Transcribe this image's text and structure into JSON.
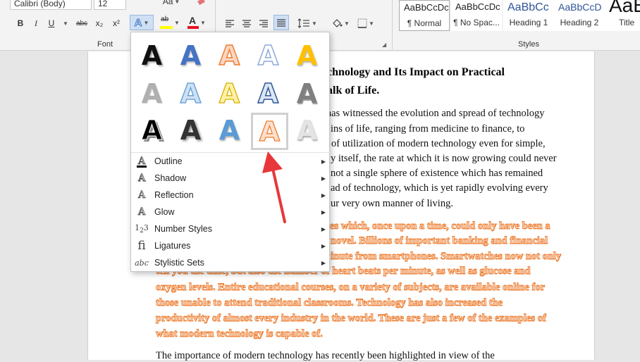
{
  "ribbon": {
    "font_name": "Calibri (Body)",
    "font_size": "12",
    "font_group_label": "Font",
    "styles_group_label": "Styles",
    "aa_label": "Aa",
    "buttons": {
      "bold": "B",
      "italic": "I",
      "underline": "U",
      "strikethrough": "abc",
      "subscript": "x₂",
      "superscript": "x²",
      "text_effects": "A",
      "highlight": "ab",
      "font_color": "A"
    },
    "styles": [
      {
        "sample": "AaBbCcDc",
        "name": "¶ Normal"
      },
      {
        "sample": "AaBbCcDc",
        "name": "¶ No Spac..."
      },
      {
        "sample": "AaBbCc",
        "name": "Heading 1"
      },
      {
        "sample": "AaBbCcD",
        "name": "Heading 2"
      },
      {
        "sample": "AaB",
        "name": "Title"
      }
    ]
  },
  "text_effects_menu": {
    "effect_glyph": "A",
    "items": [
      {
        "label": "Outline",
        "icon": "outline-icon"
      },
      {
        "label": "Shadow",
        "icon": "shadow-icon"
      },
      {
        "label": "Reflection",
        "icon": "reflection-icon"
      },
      {
        "label": "Glow",
        "icon": "glow-icon"
      },
      {
        "label": "Number Styles",
        "icon": "number-styles-icon"
      },
      {
        "label": "Ligatures",
        "icon": "ligatures-icon"
      },
      {
        "label": "Stylistic Sets",
        "icon": "stylistic-sets-icon"
      }
    ]
  },
  "document": {
    "title_line1": "chnology and Its Impact on Practical",
    "title_line2": "alk of Life.",
    "para1": [
      "d has witnessed the evolution and spread of technology",
      "ins of life, ranging from medicine to finance, to",
      "of utilization of modern technology even for simple,",
      "y itself, the rate at which it is now growing could never",
      "not a single sphere of existence which has remained",
      "ad of technology, which is yet rapidly evolving every",
      "ur very own manner of living."
    ],
    "para2": [
      "ies which, once upon a time, could only have been a",
      "novel. Billions of important banking and financial",
      "inute from smartphones. Smartwatches now not only",
      "tell you the time, but also the number of heart beats per minute, as well as glucose and",
      "oxygen levels. Entire educational courses, on a variety of subjects, are available online for",
      "those unable to attend traditional classrooms. Technology has also increased the",
      "productivity of almost every industry in the world. These are just a few of the examples of",
      "what modern technology is capable of."
    ],
    "para3_line1": "The importance of modern technology has recently been highlighted in view of the"
  },
  "colors": {
    "accent_orange": "#ec7d31",
    "annotation_red": "#e8373a",
    "selection_blue": "#cfe0f5"
  }
}
